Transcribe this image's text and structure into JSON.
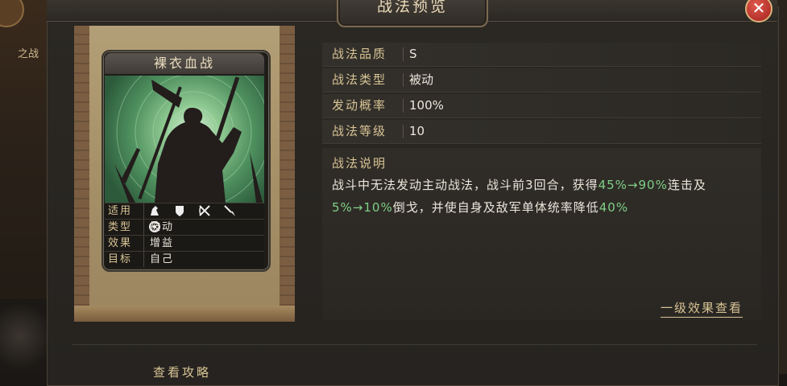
{
  "background": {
    "left_tag": "之战"
  },
  "dialog": {
    "title": "战法预览",
    "close_icon": "close-icon"
  },
  "card": {
    "name": "裸衣血战",
    "applicable_label": "适用",
    "applicable_icons": [
      "cavalry-icon",
      "shield-icon",
      "bow-icon",
      "spear-icon",
      "siege-icon"
    ],
    "type_label": "类型",
    "type_value": "被动",
    "effect_label": "效果",
    "effect_value": "增益",
    "target_label": "目标",
    "target_value": "自己"
  },
  "props": [
    {
      "label": "战法品质",
      "value": "S"
    },
    {
      "label": "战法类型",
      "value": "被动"
    },
    {
      "label": "发动概率",
      "value": "100%"
    },
    {
      "label": "战法等级",
      "value": "10"
    }
  ],
  "description": {
    "label": "战法说明",
    "p1": "战斗中无法发动主动战法，战斗前",
    "n3": "3",
    "p2": "回合，获得",
    "g1": "45%→90%",
    "p3": "连击及",
    "g2": "5%→10%",
    "p4": "倒戈，并使自身及敌军单体统率降低",
    "g3": "40%"
  },
  "level_link": "一级效果查看",
  "guide_link": "查看攻略",
  "colors": {
    "accent": "#d8c495",
    "green": "#7fcf86",
    "close": "#c0392b"
  }
}
